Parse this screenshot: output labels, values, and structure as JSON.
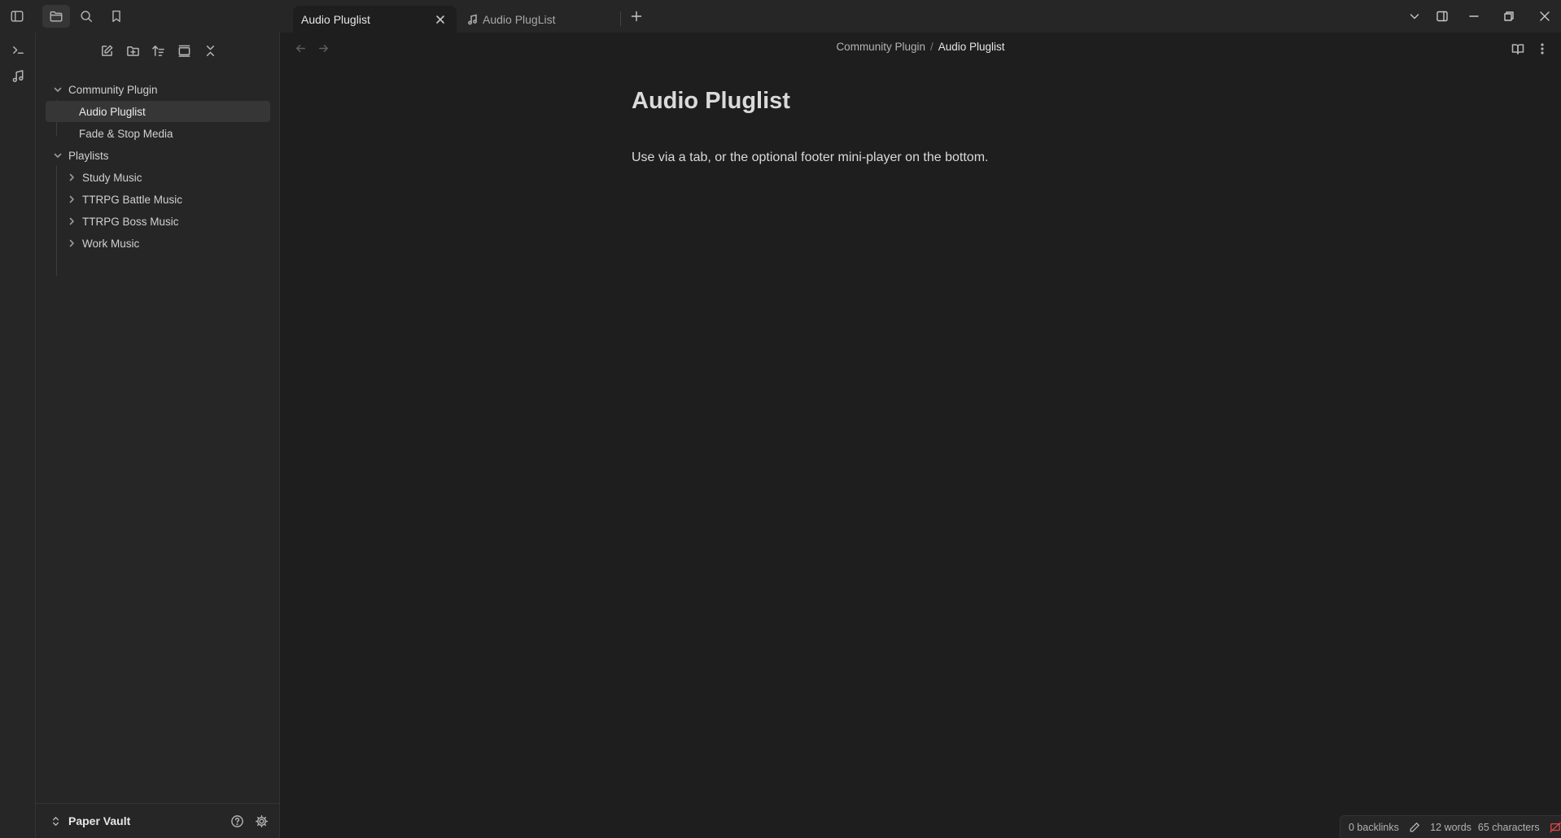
{
  "tabs": [
    {
      "label": "Audio Pluglist",
      "active": true
    },
    {
      "label": "Audio PlugList",
      "active": false,
      "icon": "music-note-icon"
    }
  ],
  "sidebar": {
    "tree": [
      {
        "label": "Community Plugin",
        "type": "folder",
        "expanded": true
      },
      {
        "label": "Audio Pluglist",
        "type": "file",
        "selected": true
      },
      {
        "label": "Fade & Stop Media",
        "type": "file"
      },
      {
        "label": "Playlists",
        "type": "folder",
        "expanded": true
      },
      {
        "label": "Study Music",
        "type": "folder",
        "expanded": false
      },
      {
        "label": "TTRPG Battle Music",
        "type": "folder",
        "expanded": false
      },
      {
        "label": "TTRPG Boss Music",
        "type": "folder",
        "expanded": false
      },
      {
        "label": "Work Music",
        "type": "folder",
        "expanded": false
      }
    ],
    "vault_name": "Paper Vault"
  },
  "breadcrumb": {
    "parent": "Community Plugin",
    "separator": "/",
    "current": "Audio Pluglist"
  },
  "document": {
    "title": "Audio Pluglist",
    "body": "Use via a tab, or the optional footer mini-player on the bottom."
  },
  "statusbar": {
    "backlinks": "0 backlinks",
    "words": "12 words",
    "characters": "65 characters"
  },
  "colors": {
    "background": "#1e1e1e",
    "sidebar": "#262626",
    "selected": "#363636",
    "sync_error": "#e0474c"
  }
}
